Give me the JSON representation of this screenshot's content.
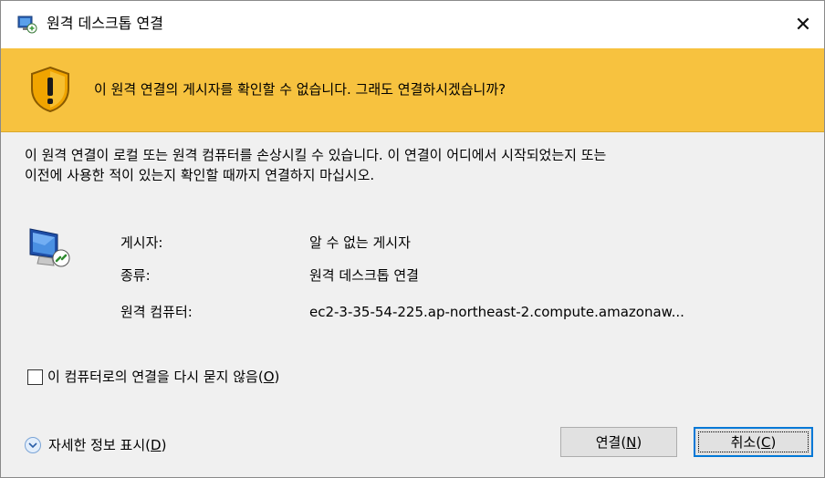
{
  "window": {
    "title": "원격 데스크톱 연결",
    "close_glyph": "✕"
  },
  "banner": {
    "text": "이 원격 연결의 게시자를 확인할 수 없습니다. 그래도 연결하시겠습니까?",
    "icon": "warning-shield-icon",
    "color": "#f7c23f"
  },
  "description": {
    "line1": "이 원격 연결이 로컬 또는 원격 컴퓨터를 손상시킬 수 있습니다. 이 연결이 어디에서 시작되었는지 또는",
    "line2": "이전에 사용한 적이 있는지 확인할 때까지 연결하지 마십시오."
  },
  "details": {
    "icon": "remote-computer-icon",
    "rows": [
      {
        "label": "게시자:",
        "value": "알 수 없는 게시자"
      },
      {
        "label": "종류:",
        "value": "원격 데스크톱 연결"
      },
      {
        "label": "원격 컴퓨터:",
        "value": "ec2-3-35-54-225.ap-northeast-2.compute.amazonaw..."
      }
    ]
  },
  "checkbox": {
    "label_prefix": "이 컴퓨터로의 연결을 다시 묻지 않음(",
    "accel": "O",
    "label_suffix": ")",
    "checked": false
  },
  "show_details": {
    "label_prefix": "자세한 정보 표시(",
    "accel": "D",
    "label_suffix": ")"
  },
  "buttons": {
    "connect": {
      "prefix": "연결(",
      "accel": "N",
      "suffix": ")"
    },
    "cancel": {
      "prefix": "취소(",
      "accel": "C",
      "suffix": ")"
    }
  }
}
